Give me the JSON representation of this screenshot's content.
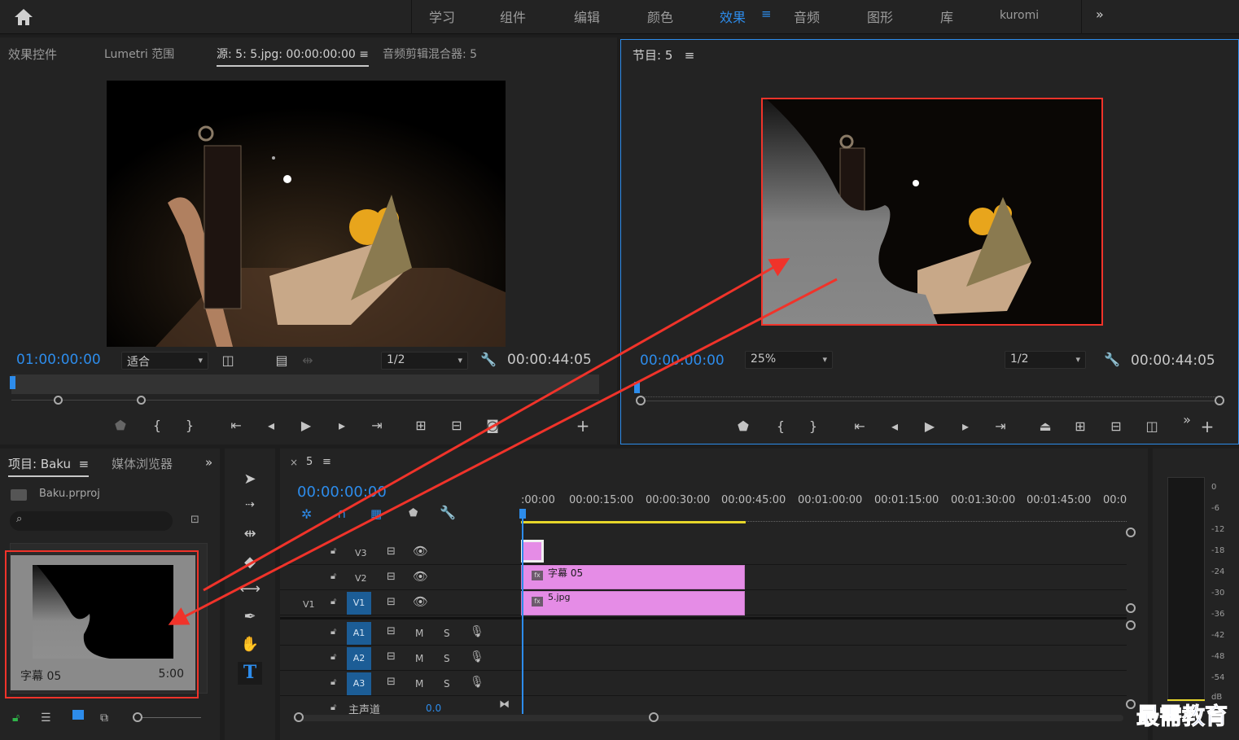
{
  "nav": {
    "items": [
      "学习",
      "组件",
      "编辑",
      "颜色",
      "效果",
      "音频",
      "图形",
      "库",
      "kuromi"
    ],
    "active": "效果",
    "more": "»"
  },
  "source_panel": {
    "tabs": [
      "效果控件",
      "Lumetri 范围",
      "源: 5: 5.jpg: 00:00:00:00",
      "音频剪辑混合器: 5"
    ],
    "timecode": "01:00:00:00",
    "fit": "适合",
    "resolution": "1/2",
    "duration": "00:00:44:05"
  },
  "program_panel": {
    "title": "节目: 5",
    "timecode": "00:00:00:00",
    "zoom": "25%",
    "resolution": "1/2",
    "duration": "00:00:44:05"
  },
  "project_panel": {
    "tab": "项目: Baku",
    "tab2": "媒体浏览器",
    "file": "Baku.prproj",
    "thumb_name": "字幕 05",
    "thumb_duration": "5:00"
  },
  "timeline": {
    "sequence": "5",
    "timecode": "00:00:00:00",
    "ruler": [
      ":00:00",
      "00:00:15:00",
      "00:00:30:00",
      "00:00:45:00",
      "00:01:00:00",
      "00:01:15:00",
      "00:01:30:00",
      "00:01:45:00",
      "00:0"
    ],
    "tracks": {
      "v3": "V3",
      "v2": "V2",
      "v1": "V1",
      "v1_src": "V1",
      "a1": "A1",
      "a2": "A2",
      "a3": "A3",
      "master": "主声道",
      "master_val": "0.0",
      "m": "M",
      "s": "S"
    },
    "clips": {
      "title": "字幕 05",
      "image": "5.jpg"
    }
  },
  "meter": {
    "labels": [
      "0",
      "-6",
      "-12",
      "-18",
      "-24",
      "-30",
      "-36",
      "-42",
      "-48",
      "-54",
      "dB"
    ]
  },
  "watermark": "最需教育",
  "colors": {
    "accent": "#2d8ceb",
    "clip": "#e58ce6",
    "arrow": "#f0332a"
  }
}
